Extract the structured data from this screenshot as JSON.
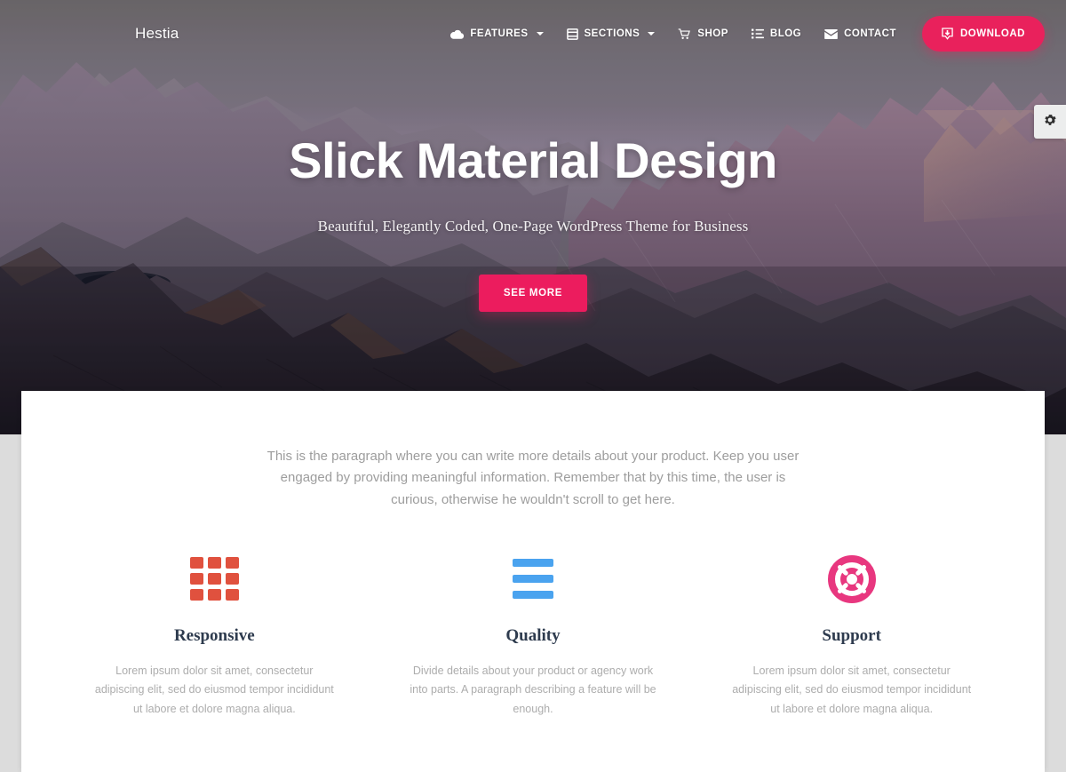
{
  "theme": {
    "accent_pink": "#e9215c",
    "accent_pink_button": "#ec1c5e",
    "icon_red": "#e0513e",
    "icon_blue": "#4aa3ef",
    "icon_magenta": "#e8377f",
    "heading_navy": "#2e3b4e",
    "page_background": "#dcdcdc",
    "card_background": "#ffffff"
  },
  "navbar": {
    "brand": "Hestia",
    "items": [
      {
        "label": "FEATURES",
        "icon": "cloud-icon",
        "has_dropdown": true
      },
      {
        "label": "SECTIONS",
        "icon": "layers-icon",
        "has_dropdown": true
      },
      {
        "label": "SHOP",
        "icon": "shopping-cart-icon",
        "has_dropdown": false
      },
      {
        "label": "BLOG",
        "icon": "list-icon",
        "has_dropdown": false
      },
      {
        "label": "CONTACT",
        "icon": "envelope-icon",
        "has_dropdown": false
      }
    ],
    "download_button": {
      "label": "DOWNLOAD",
      "icon": "download-icon"
    }
  },
  "gear_tab": {
    "icon": "gear-icon"
  },
  "hero": {
    "title": "Slick Material Design",
    "subtitle": "Beautiful, Elegantly Coded, One-Page WordPress Theme for Business",
    "cta_label": "SEE MORE"
  },
  "content": {
    "intro_paragraph": "This is the paragraph where you can write more details about your product. Keep you user engaged by providing meaningful information. Remember that by this time, the user is curious, otherwise he wouldn't scroll to get here.",
    "features": [
      {
        "icon": "grid-icon",
        "title": "Responsive",
        "description": "Lorem ipsum dolor sit amet, consectetur adipiscing elit, sed do eiusmod tempor incididunt ut labore et dolore magna aliqua."
      },
      {
        "icon": "bars-icon",
        "title": "Quality",
        "description": "Divide details about your product or agency work into parts. A paragraph describing a feature will be enough."
      },
      {
        "icon": "life-ring-icon",
        "title": "Support",
        "description": "Lorem ipsum dolor sit amet, consectetur adipiscing elit, sed do eiusmod tempor incididunt ut labore et dolore magna aliqua."
      }
    ]
  }
}
